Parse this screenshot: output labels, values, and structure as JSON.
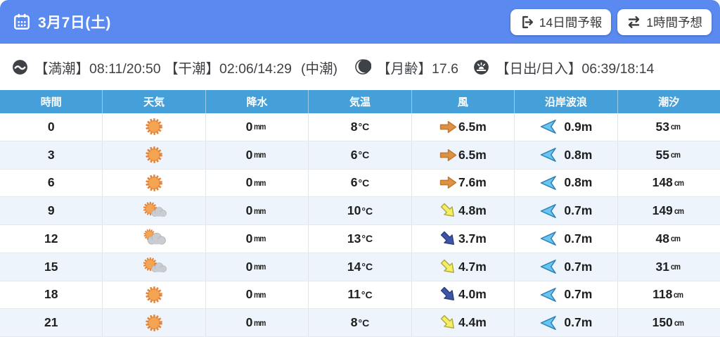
{
  "header": {
    "date_label": "3月7日(土)",
    "buttons": [
      {
        "label": "14日間予報",
        "icon": "exit-right-icon"
      },
      {
        "label": "1時間予想",
        "icon": "swap-icon"
      }
    ]
  },
  "info_bar": {
    "tide_times": "【満潮】08:11/20:50 【干潮】02:06/14:29",
    "tide_phase": "(中潮)",
    "moon_age": "【月齢】17.6",
    "sunrise_sunset": "【日出/日入】06:39/18:14"
  },
  "table": {
    "columns": [
      "時間",
      "天気",
      "降水",
      "気温",
      "風",
      "沿岸波浪",
      "潮汐"
    ],
    "rows": [
      {
        "time": "0",
        "weather_icon": "sun-icon",
        "precip": "0",
        "precip_unit": "mm",
        "temp": "8",
        "temp_unit": "°C",
        "wind_speed": "6.5m",
        "wind_dir": "right",
        "wind_color": "orange",
        "wave_height": "0.9m",
        "tide": "53",
        "tide_unit": "cm"
      },
      {
        "time": "3",
        "weather_icon": "sun-icon",
        "precip": "0",
        "precip_unit": "mm",
        "temp": "6",
        "temp_unit": "°C",
        "wind_speed": "6.5m",
        "wind_dir": "right",
        "wind_color": "orange",
        "wave_height": "0.8m",
        "tide": "55",
        "tide_unit": "cm"
      },
      {
        "time": "6",
        "weather_icon": "sun-icon",
        "precip": "0",
        "precip_unit": "mm",
        "temp": "6",
        "temp_unit": "°C",
        "wind_speed": "7.6m",
        "wind_dir": "right",
        "wind_color": "orange",
        "wave_height": "0.8m",
        "tide": "148",
        "tide_unit": "cm"
      },
      {
        "time": "9",
        "weather_icon": "sun-cloud-icon",
        "precip": "0",
        "precip_unit": "mm",
        "temp": "10",
        "temp_unit": "°C",
        "wind_speed": "4.8m",
        "wind_dir": "down-right",
        "wind_color": "yellow",
        "wave_height": "0.7m",
        "tide": "149",
        "tide_unit": "cm"
      },
      {
        "time": "12",
        "weather_icon": "cloud-sun-icon",
        "precip": "0",
        "precip_unit": "mm",
        "temp": "13",
        "temp_unit": "°C",
        "wind_speed": "3.7m",
        "wind_dir": "down-right",
        "wind_color": "blue",
        "wave_height": "0.7m",
        "tide": "48",
        "tide_unit": "cm"
      },
      {
        "time": "15",
        "weather_icon": "sun-cloud-icon",
        "precip": "0",
        "precip_unit": "mm",
        "temp": "14",
        "temp_unit": "°C",
        "wind_speed": "4.7m",
        "wind_dir": "down-right",
        "wind_color": "yellow",
        "wave_height": "0.7m",
        "tide": "31",
        "tide_unit": "cm"
      },
      {
        "time": "18",
        "weather_icon": "sun-icon",
        "precip": "0",
        "precip_unit": "mm",
        "temp": "11",
        "temp_unit": "°C",
        "wind_speed": "4.0m",
        "wind_dir": "down-right",
        "wind_color": "blue",
        "wave_height": "0.7m",
        "tide": "118",
        "tide_unit": "cm"
      },
      {
        "time": "21",
        "weather_icon": "sun-icon",
        "precip": "0",
        "precip_unit": "mm",
        "temp": "8",
        "temp_unit": "°C",
        "wind_speed": "4.4m",
        "wind_dir": "down-right",
        "wind_color": "yellow",
        "wave_height": "0.7m",
        "tide": "150",
        "tide_unit": "cm"
      }
    ]
  },
  "colors": {
    "topbar_bg": "#5a8af0",
    "table_header_bg": "#459fd9",
    "row_alt_bg": "#edf4fb",
    "sun_core": "#f3a553",
    "sun_edge": "#e2813a",
    "cloud_gray": "#c9cdd2",
    "wind_orange": "#de9143",
    "wind_yellow": "#f4ee67",
    "wind_blue": "#3c55a6",
    "wave_fill": "#66c5f1",
    "wave_edge": "#2f7fb5",
    "info_dark": "#3e4246"
  }
}
